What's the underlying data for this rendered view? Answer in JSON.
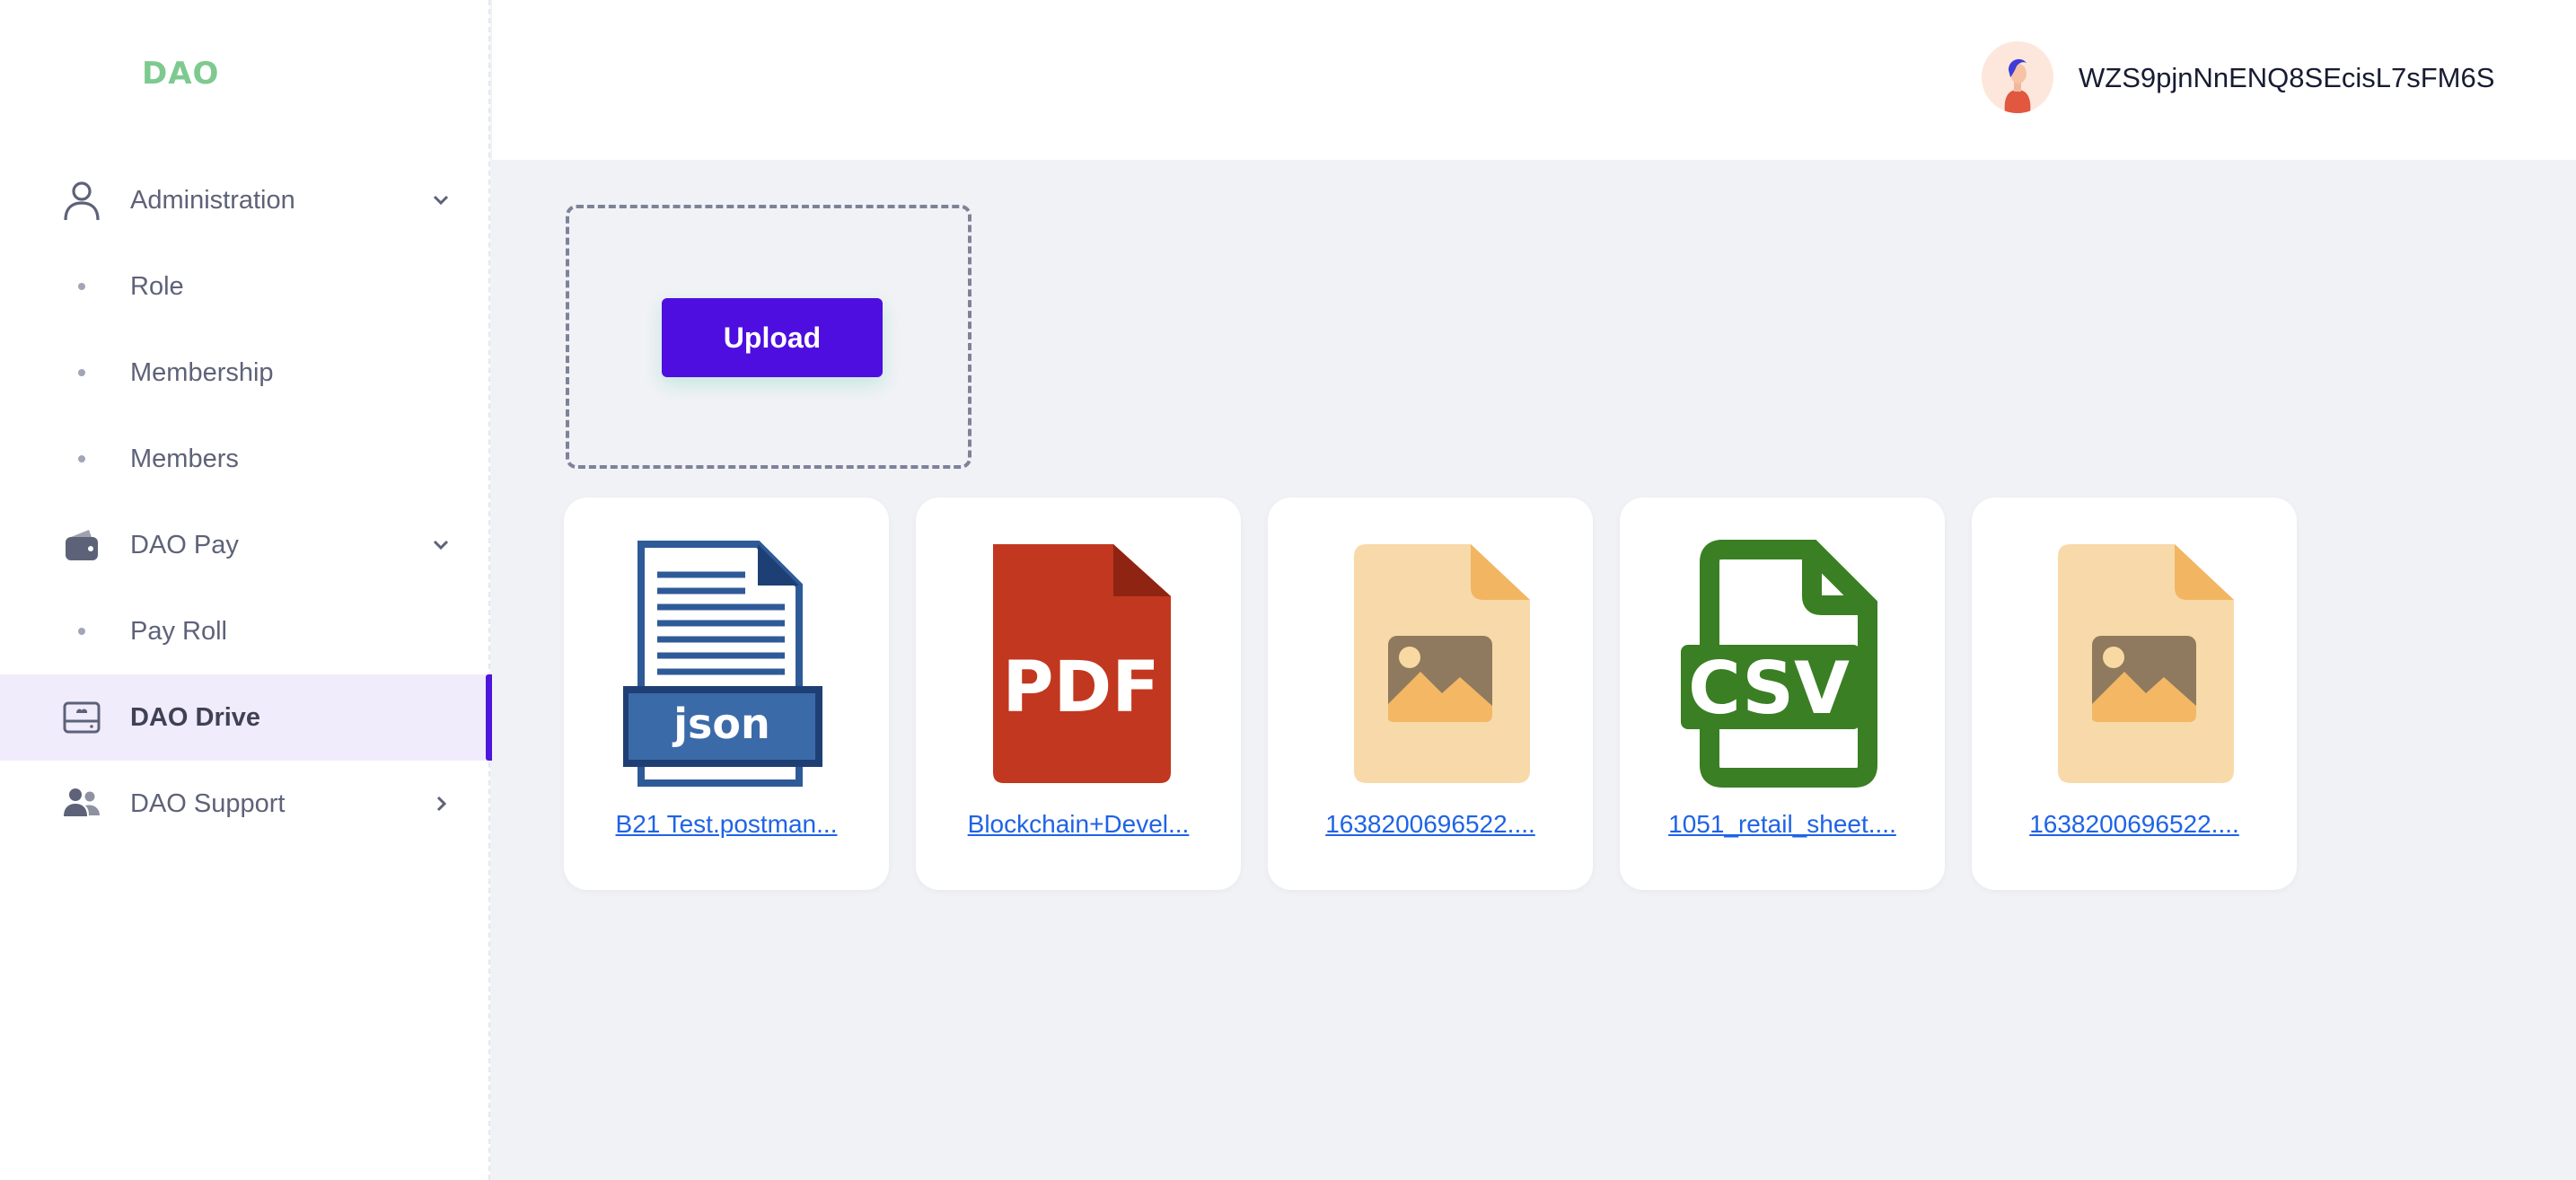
{
  "sidebar": {
    "logo": "DAO",
    "items": [
      {
        "label": "Administration",
        "icon": "user-icon",
        "expandable": true
      },
      {
        "label": "Role",
        "sub": true
      },
      {
        "label": "Membership",
        "sub": true
      },
      {
        "label": "Members",
        "sub": true
      },
      {
        "label": "DAO Pay",
        "icon": "wallet-icon",
        "expandable": true
      },
      {
        "label": "Pay Roll",
        "sub": true
      },
      {
        "label": "DAO Drive",
        "icon": "drive-icon",
        "active": true
      },
      {
        "label": "DAO Support",
        "icon": "people-icon",
        "expandable": true
      }
    ]
  },
  "header": {
    "username": "WZS9pjnNnENQ8SEcisL7sFM6S",
    "avatar_icon": "avatar-icon"
  },
  "upload": {
    "button_label": "Upload"
  },
  "files": [
    {
      "name": "B21 Test.postman...",
      "icon": "json-file-icon",
      "badge": "json"
    },
    {
      "name": "Blockchain+Devel...",
      "icon": "pdf-file-icon",
      "badge": "PDF"
    },
    {
      "name": "1638200696522....",
      "icon": "image-file-icon"
    },
    {
      "name": "1051_retail_sheet....",
      "icon": "csv-file-icon",
      "badge": "CSV"
    },
    {
      "name": "1638200696522....",
      "icon": "image-file-icon"
    }
  ],
  "colors": {
    "accent": "#4e0ee0",
    "logo": "#7ec98f",
    "link": "#1f63e6",
    "active_bg": "#f0ecfc"
  }
}
